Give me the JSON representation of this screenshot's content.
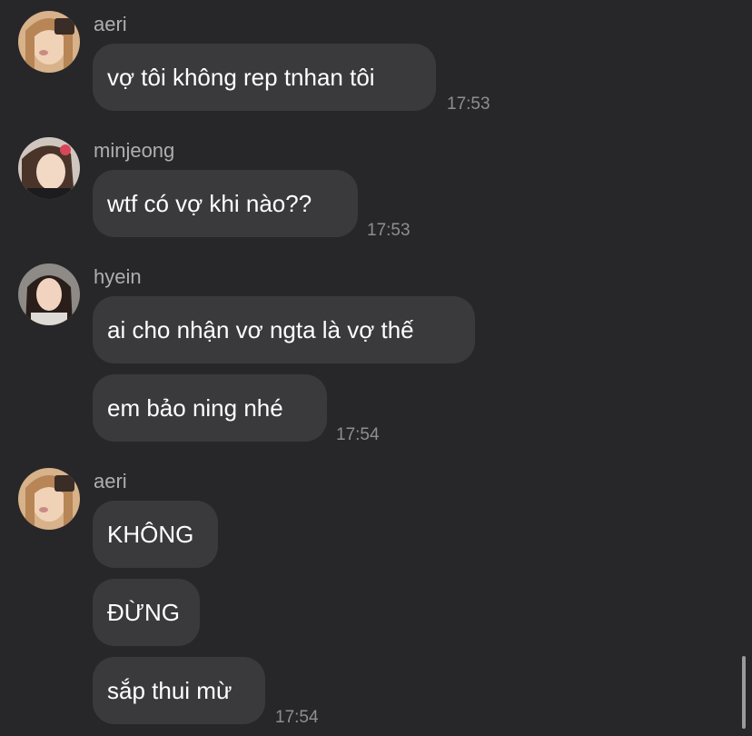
{
  "messages": [
    {
      "sender": "aeri",
      "avatar": "aeri-avatar",
      "texts": [
        "vợ tôi không rep tnhan tôi"
      ],
      "time": "17:53"
    },
    {
      "sender": "minjeong",
      "avatar": "minjeong-avatar",
      "texts": [
        "wtf có vợ khi nào??"
      ],
      "time": "17:53"
    },
    {
      "sender": "hyein",
      "avatar": "hyein-avatar",
      "texts": [
        "ai cho nhận vơ ngta là vợ thế",
        "em bảo ning nhé"
      ],
      "time": "17:54"
    },
    {
      "sender": "aeri",
      "avatar": "aeri-avatar",
      "texts": [
        "KHÔNG",
        "ĐỪNG",
        "sắp thui mừ"
      ],
      "time": "17:54"
    }
  ],
  "colors": {
    "background": "#272729",
    "bubble": "#3a3a3c",
    "sender_name": "#aeaeb2",
    "timestamp": "#8e8e93",
    "message_text": "#ffffff"
  }
}
